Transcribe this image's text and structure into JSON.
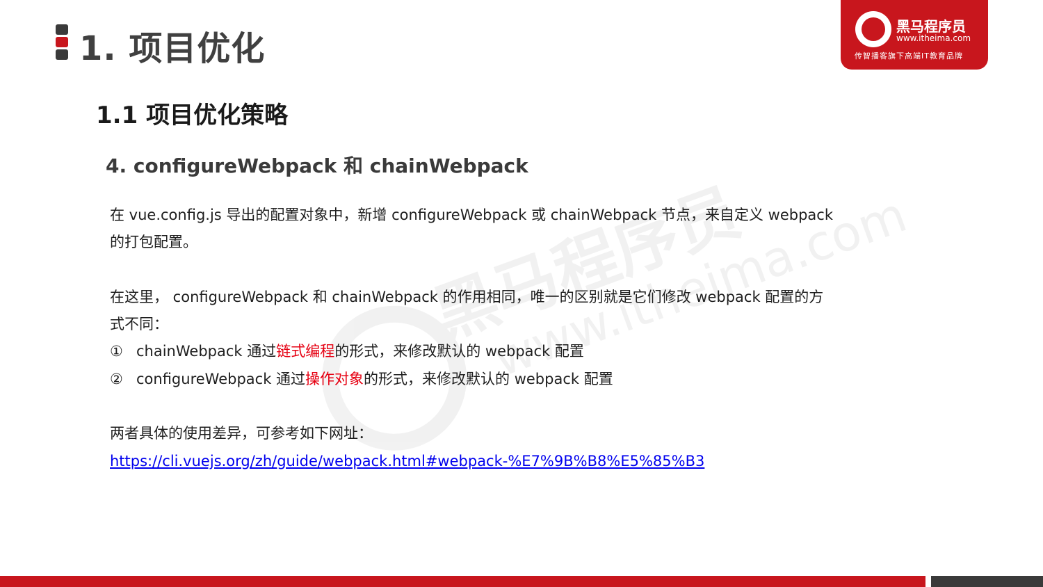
{
  "page_title": "1. 项目优化",
  "logo": {
    "name": "黑马程序员",
    "url": "www.itheima.com",
    "slogan": "传智播客旗下高端IT教育品牌"
  },
  "watermark": {
    "name": "黑马程序员",
    "url": "www.itheima.com"
  },
  "section_title": "1.1 项目优化策略",
  "sub_title": "4. configureWebpack 和 chainWebpack",
  "paragraph1": {
    "line1": "在 vue.config.js 导出的配置对象中，新增 configureWebpack 或 chainWebpack 节点，来自定义 webpack",
    "line2": "的打包配置。"
  },
  "paragraph2": {
    "line1": "在这里， configureWebpack 和 chainWebpack 的作用相同，唯一的区别就是它们修改 webpack 配置的方",
    "line2": "式不同："
  },
  "list": [
    {
      "marker": "①",
      "before": "chainWebpack 通过",
      "highlight": "链式编程",
      "after": "的形式，来修改默认的 webpack 配置"
    },
    {
      "marker": "②",
      "before": "configureWebpack 通过",
      "highlight": "操作对象",
      "after": "的形式，来修改默认的 webpack 配置"
    }
  ],
  "reference": {
    "intro": "两者具体的使用差异，可参考如下网址：",
    "link": "https://cli.vuejs.org/zh/guide/webpack.html#webpack-%E7%9B%B8%E5%85%B3"
  },
  "colors": {
    "brand_red": "#c8161d",
    "highlight_red": "#e60012",
    "link_blue": "#0000ee",
    "dark_gray": "#3a3a3a"
  }
}
